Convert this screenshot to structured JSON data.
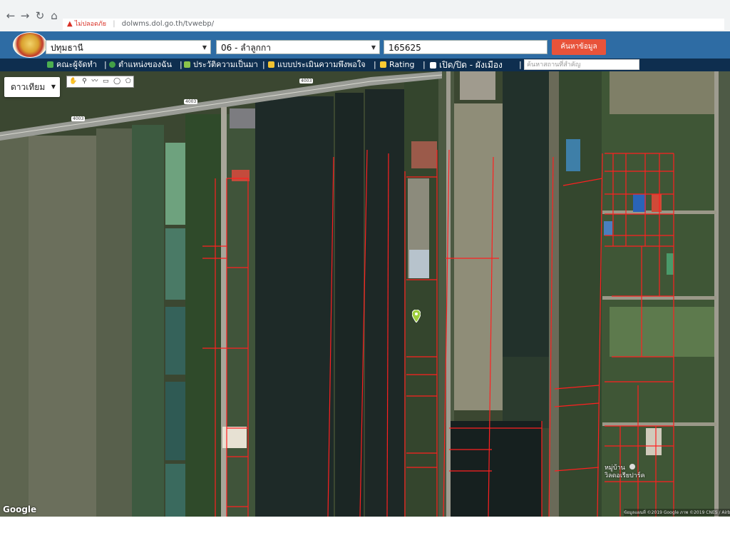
{
  "browser": {
    "security_warning": "ไม่ปลอดภัย",
    "url": "dolwms.dol.go.th/tvwebp/"
  },
  "search": {
    "province": "ปทุมธานี",
    "district": "06 - ลำลูกกา",
    "parcel_number": "165625",
    "search_button": "ค้นหาข้อมูล"
  },
  "menu": {
    "items": [
      {
        "label": "คณะผู้จัดทำ",
        "icon": "person-icon"
      },
      {
        "label": "ตำแหน่งของฉัน",
        "icon": "location-icon"
      },
      {
        "label": "ประวัติความเป็นมา",
        "icon": "history-icon"
      },
      {
        "label": "แบบประเมินความพึงพอใจ",
        "icon": "survey-icon"
      },
      {
        "label": "Rating",
        "icon": "rating-icon"
      },
      {
        "label": "เปิด/ปิด - ผังเมือง",
        "icon": "toggle-icon"
      }
    ],
    "place_search_placeholder": "ค้นหาสถานที่สำคัญ"
  },
  "map": {
    "layer_type": "ดาวเทียม",
    "road_number": "4003",
    "village_label_line1": "หมู่บ้าน",
    "village_label_line2": "วิลดอเรียปาร์ค",
    "google_logo": "Google",
    "attribution": "ข้อมูลแผนที่ ©2019 Google ภาพ ©2019 CNES / Airbus",
    "marker": "map-pin-icon",
    "parcel_line_color": "#ff2020"
  }
}
